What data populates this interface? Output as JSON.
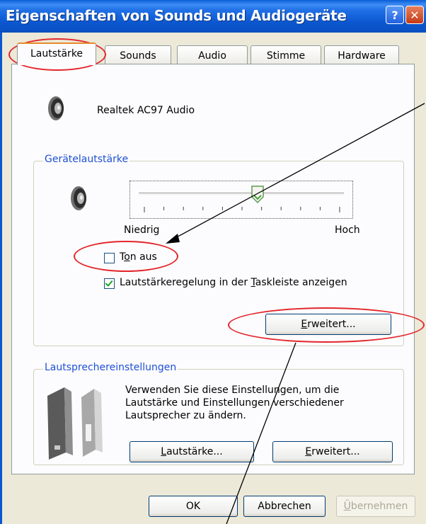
{
  "window": {
    "title": "Eigenschaften von Sounds und Audiogeräte",
    "help_glyph": "?",
    "close_glyph": "✕"
  },
  "tabs": [
    {
      "label": "Lautstärke",
      "active": true
    },
    {
      "label": "Sounds",
      "active": false
    },
    {
      "label": "Audio",
      "active": false
    },
    {
      "label": "Stimme",
      "active": false
    },
    {
      "label": "Hardware",
      "active": false
    }
  ],
  "device": {
    "name": "Realtek AC97 Audio",
    "icon": "speaker-icon"
  },
  "device_volume": {
    "group_label": "Gerätelautstärke",
    "low_label": "Niedrig",
    "high_label": "Hoch",
    "slider_level": 0.58,
    "mute": {
      "label_pre": "T",
      "label_u": "o",
      "label_post": "n aus",
      "checked": false
    },
    "show_in_taskbar": {
      "label_pre": "Lautstärkeregelung in der ",
      "label_u": "T",
      "label_post": "askleiste anzeigen",
      "checked": true
    },
    "advanced_button": {
      "u": "E",
      "rest": "rweitert..."
    }
  },
  "speaker_settings": {
    "group_label": "Lautsprechereinstellungen",
    "description_lines": [
      "Verwenden Sie diese Einstellungen, um die",
      "Lautstärke und Einstellungen verschiedener",
      "Lautsprecher zu ändern."
    ],
    "volume_button": {
      "u": "L",
      "rest": "autstärke..."
    },
    "advanced_button": {
      "u": "E",
      "rest": "rweitert..."
    }
  },
  "footer": {
    "ok": "OK",
    "cancel": "Abbrechen",
    "apply": {
      "u": "Ü",
      "rest": "bernehmen"
    }
  },
  "colors": {
    "titlebar": "#0b57cf",
    "dialog_bg": "#ece9d8",
    "group_label": "#1e50d2",
    "annotation": "#e3262b"
  }
}
